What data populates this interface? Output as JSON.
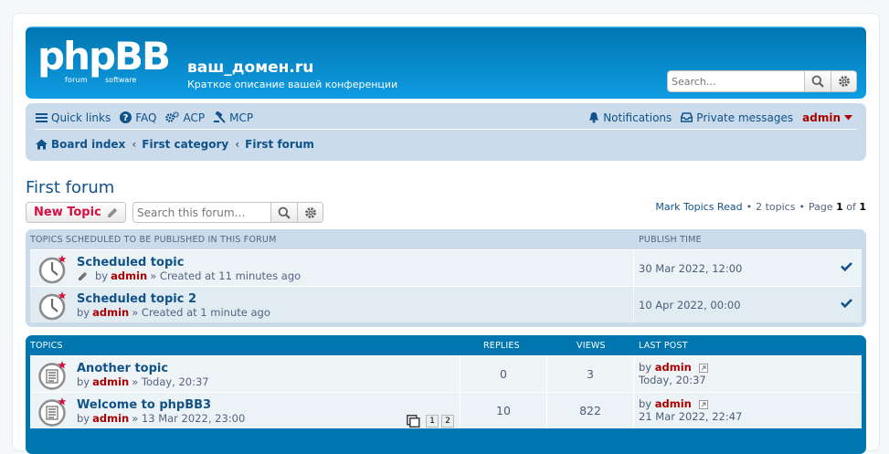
{
  "header": {
    "logo_text": "phpBB",
    "logo_sub1": "forum",
    "logo_sub2": "software",
    "site_title": "ваш_домен.ru",
    "site_description": "Краткое описание вашей конференции",
    "search_placeholder": "Search…"
  },
  "navbar": {
    "quick_links": "Quick links",
    "faq": "FAQ",
    "acp": "ACP",
    "mcp": "MCP",
    "notifications": "Notifications",
    "private_messages": "Private messages",
    "username": "admin",
    "breadcrumbs": [
      "Board index",
      "First category",
      "First forum"
    ]
  },
  "forum": {
    "title": "First forum",
    "new_topic_label": "New Topic",
    "search_placeholder": "Search this forum…",
    "mark_read": "Mark Topics Read",
    "topics_count": "2 topics",
    "page_label": "Page",
    "page_current": "1",
    "page_of": "of",
    "page_total": "1",
    "bullet": "•"
  },
  "scheduled": {
    "header": "Topics scheduled to be published in this forum",
    "col_time": "Publish time",
    "rows": [
      {
        "title": "Scheduled topic",
        "by": "by",
        "author": "admin",
        "meta": "» Created at 11 minutes ago",
        "time": "30 Mar 2022, 12:00"
      },
      {
        "title": "Scheduled topic 2",
        "by": "by",
        "author": "admin",
        "meta": "» Created at 1 minute ago",
        "time": "10 Apr 2022, 00:00"
      }
    ]
  },
  "topics": {
    "header": "Topics",
    "col_replies": "Replies",
    "col_views": "Views",
    "col_last": "Last post",
    "rows": [
      {
        "title": "Another topic",
        "by": "by",
        "author": "admin",
        "meta": "» Today, 20:37",
        "replies": "0",
        "views": "3",
        "lp_by": "by",
        "lp_author": "admin",
        "lp_time": "Today, 20:37"
      },
      {
        "title": "Welcome to phpBB3",
        "by": "by",
        "author": "admin",
        "meta": "» 13 Mar 2022, 23:00",
        "replies": "10",
        "views": "822",
        "lp_by": "by",
        "lp_author": "admin",
        "lp_time": "21 Mar 2022, 22:47",
        "pages": [
          "1",
          "2"
        ]
      }
    ]
  },
  "colors": {
    "header_blue": "#12a3eb",
    "link_blue": "#105289",
    "author_red": "#aa0000",
    "new_topic_red": "#d31141"
  }
}
